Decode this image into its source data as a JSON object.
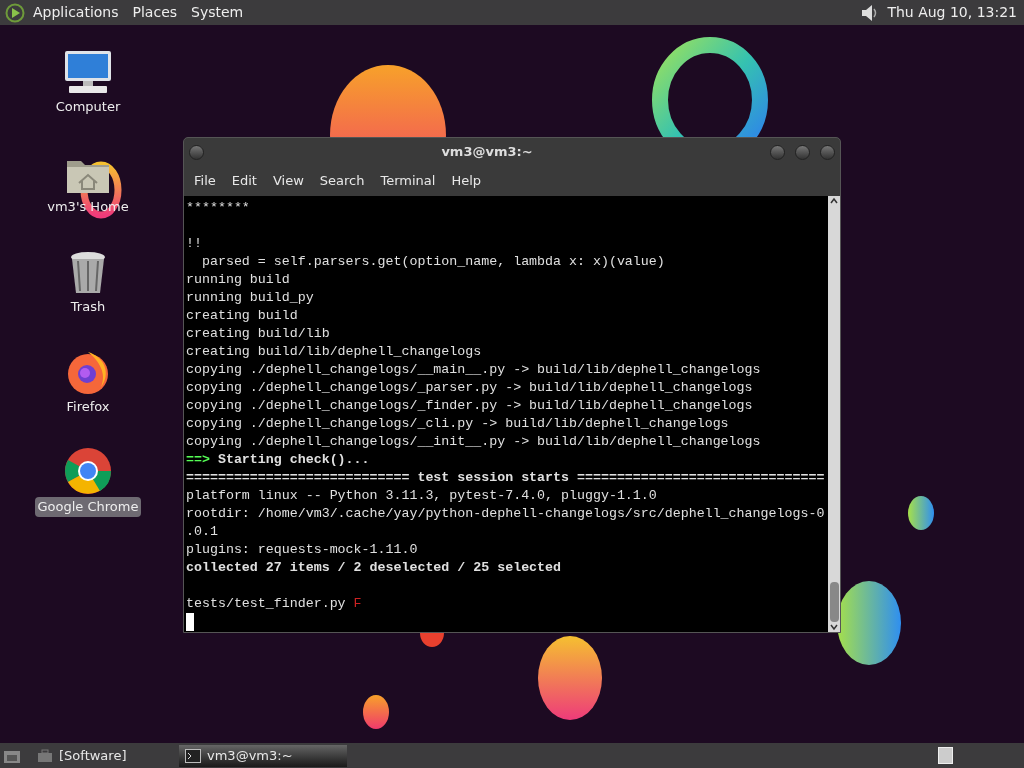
{
  "top_panel": {
    "menus": [
      "Applications",
      "Places",
      "System"
    ],
    "clock": "Thu Aug 10, 13:21"
  },
  "desktop_icons": [
    {
      "kind": "computer",
      "label": "Computer",
      "selected": false
    },
    {
      "kind": "home",
      "label": "vm3's Home",
      "selected": false
    },
    {
      "kind": "trash",
      "label": "Trash",
      "selected": false
    },
    {
      "kind": "firefox",
      "label": "Firefox",
      "selected": false
    },
    {
      "kind": "chrome",
      "label": "Google Chrome",
      "selected": true
    }
  ],
  "terminal": {
    "title": "vm3@vm3:~",
    "menu": [
      "File",
      "Edit",
      "View",
      "Search",
      "Terminal",
      "Help"
    ],
    "lines": [
      {
        "kind": "output",
        "segments": [
          {
            "text": "********",
            "kind": "normal"
          }
        ]
      },
      {
        "kind": "blank"
      },
      {
        "kind": "output",
        "segments": [
          {
            "text": "!!",
            "kind": "normal"
          }
        ]
      },
      {
        "kind": "output",
        "segments": [
          {
            "text": "  parsed = self.parsers.get(option_name, lambda x: x)(value)",
            "kind": "normal"
          }
        ]
      },
      {
        "kind": "output",
        "segments": [
          {
            "text": "running build",
            "kind": "normal"
          }
        ]
      },
      {
        "kind": "output",
        "segments": [
          {
            "text": "running build_py",
            "kind": "normal"
          }
        ]
      },
      {
        "kind": "output",
        "segments": [
          {
            "text": "creating build",
            "kind": "normal"
          }
        ]
      },
      {
        "kind": "output",
        "segments": [
          {
            "text": "creating build/lib",
            "kind": "normal"
          }
        ]
      },
      {
        "kind": "output",
        "segments": [
          {
            "text": "creating build/lib/dephell_changelogs",
            "kind": "normal"
          }
        ]
      },
      {
        "kind": "output",
        "segments": [
          {
            "text": "copying ./dephell_changelogs/__main__.py -> build/lib/dephell_changelogs",
            "kind": "normal"
          }
        ]
      },
      {
        "kind": "output",
        "segments": [
          {
            "text": "copying ./dephell_changelogs/_parser.py -> build/lib/dephell_changelogs",
            "kind": "normal"
          }
        ]
      },
      {
        "kind": "output",
        "segments": [
          {
            "text": "copying ./dephell_changelogs/_finder.py -> build/lib/dephell_changelogs",
            "kind": "normal"
          }
        ]
      },
      {
        "kind": "output",
        "segments": [
          {
            "text": "copying ./dephell_changelogs/_cli.py -> build/lib/dephell_changelogs",
            "kind": "normal"
          }
        ]
      },
      {
        "kind": "output",
        "segments": [
          {
            "text": "copying ./dephell_changelogs/__init__.py -> build/lib/dephell_changelogs",
            "kind": "normal"
          }
        ]
      },
      {
        "kind": "output",
        "segments": [
          {
            "text": "==>",
            "kind": "prompt"
          },
          {
            "text": " Starting check()...",
            "kind": "heading"
          }
        ]
      },
      {
        "kind": "output",
        "segments": [
          {
            "text": "============================ test session starts ===============================",
            "kind": "heading"
          }
        ]
      },
      {
        "kind": "output",
        "segments": [
          {
            "text": "platform linux -- Python 3.11.3, pytest-7.4.0, pluggy-1.1.0",
            "kind": "normal"
          }
        ]
      },
      {
        "kind": "output",
        "segments": [
          {
            "text": "rootdir: /home/vm3/.cache/yay/python-dephell-changelogs/src/dephell_changelogs-0",
            "kind": "normal"
          }
        ]
      },
      {
        "kind": "output",
        "segments": [
          {
            "text": ".0.1",
            "kind": "normal"
          }
        ]
      },
      {
        "kind": "output",
        "segments": [
          {
            "text": "plugins: requests-mock-1.11.0",
            "kind": "normal"
          }
        ]
      },
      {
        "kind": "output",
        "segments": [
          {
            "text": "collected 27 items / 2 deselected / 25 selected",
            "kind": "heading"
          }
        ]
      },
      {
        "kind": "blank"
      },
      {
        "kind": "output",
        "segments": [
          {
            "text": "tests/test_finder.py ",
            "kind": "normal"
          },
          {
            "text": "F",
            "kind": "failure"
          }
        ]
      },
      {
        "kind": "cursor"
      }
    ]
  },
  "taskbar": {
    "items": [
      {
        "label": "[Software]",
        "kind": "folder",
        "selected": false
      },
      {
        "label": "vm3@vm3:~",
        "kind": "terminal",
        "selected": true
      }
    ]
  }
}
